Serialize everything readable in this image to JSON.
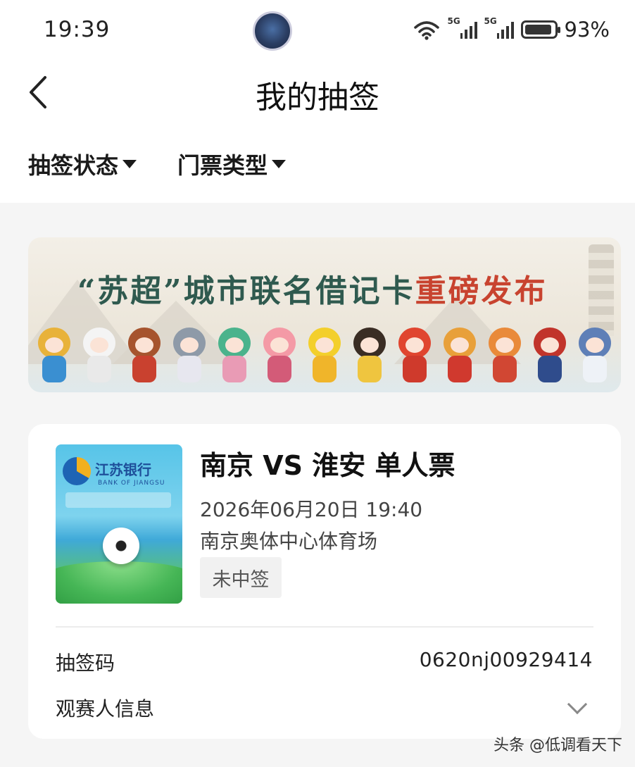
{
  "status_bar": {
    "time": "19:39",
    "signal1_label": "5G",
    "signal2_label": "5G",
    "battery_percent": "93%",
    "battery_level": 0.93
  },
  "header": {
    "title": "我的抽签",
    "filters": [
      {
        "label": "抽签状态"
      },
      {
        "label": "门票类型"
      }
    ]
  },
  "banner": {
    "title_part1": "“苏超”城市联名借记卡",
    "title_part2": "重磅发布"
  },
  "ticket": {
    "thumbnail": {
      "brand": "江苏银行",
      "brand_en": "BANK OF JIANGSU"
    },
    "title": "南京 VS 淮安 单人票",
    "datetime": "2026年06月20日 19:40",
    "venue": "南京奥体中心体育场",
    "status": "未中签",
    "draw_code_label": "抽签码",
    "draw_code": "0620nj00929414",
    "spectator_label": "观赛人信息"
  },
  "watermark": "头条 @低调看天下",
  "colors": {
    "banner_green": "#2f5a4f",
    "banner_red": "#c8432f",
    "page_bg": "#f5f5f5"
  }
}
